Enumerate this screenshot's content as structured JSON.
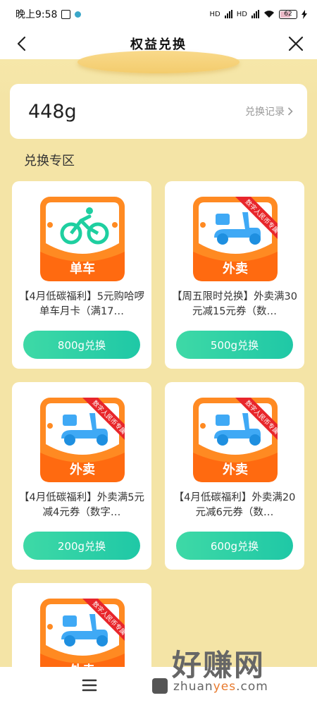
{
  "status_bar": {
    "time": "晚上9:58",
    "hd1": "HD",
    "hd2": "HD",
    "battery": "62"
  },
  "nav": {
    "title": "权益兑换"
  },
  "balance": {
    "value": "448g",
    "record_link": "兑换记录"
  },
  "section_title": "兑换专区",
  "cards": [
    {
      "title": "【4月低碳福利】5元购哈啰单车月卡（满17…",
      "icon_label": "单车",
      "icon": "bike-icon",
      "has_ribbon": false,
      "button": "800g兑换"
    },
    {
      "title": "【周五限时兑换】外卖满30元减15元券（数…",
      "icon_label": "外卖",
      "icon": "scooter-icon",
      "has_ribbon": true,
      "ribbon": "数字人民币专属",
      "button": "500g兑换"
    },
    {
      "title": "【4月低碳福利】外卖满5元减4元券（数字…",
      "icon_label": "外卖",
      "icon": "scooter-icon",
      "has_ribbon": true,
      "ribbon": "数字人民币专属",
      "button": "200g兑换"
    },
    {
      "title": "【4月低碳福利】外卖满20元减6元券（数…",
      "icon_label": "外卖",
      "icon": "scooter-icon",
      "has_ribbon": true,
      "ribbon": "数字人民币专属",
      "button": "600g兑换"
    },
    {
      "title": "",
      "icon_label": "外卖",
      "icon": "scooter-icon",
      "has_ribbon": true,
      "ribbon": "数字人民币专属",
      "button": ""
    }
  ],
  "watermark": {
    "big": "好赚网",
    "small_pre": "zhuan",
    "small_hl": "yes",
    "small_post": ".com"
  },
  "colors": {
    "page_bg": "#F4E4A6",
    "button_start": "#3ED9A6",
    "button_end": "#1FC8A6",
    "icon_orange": "#FF7A1A",
    "ribbon_red": "#E8262B"
  }
}
